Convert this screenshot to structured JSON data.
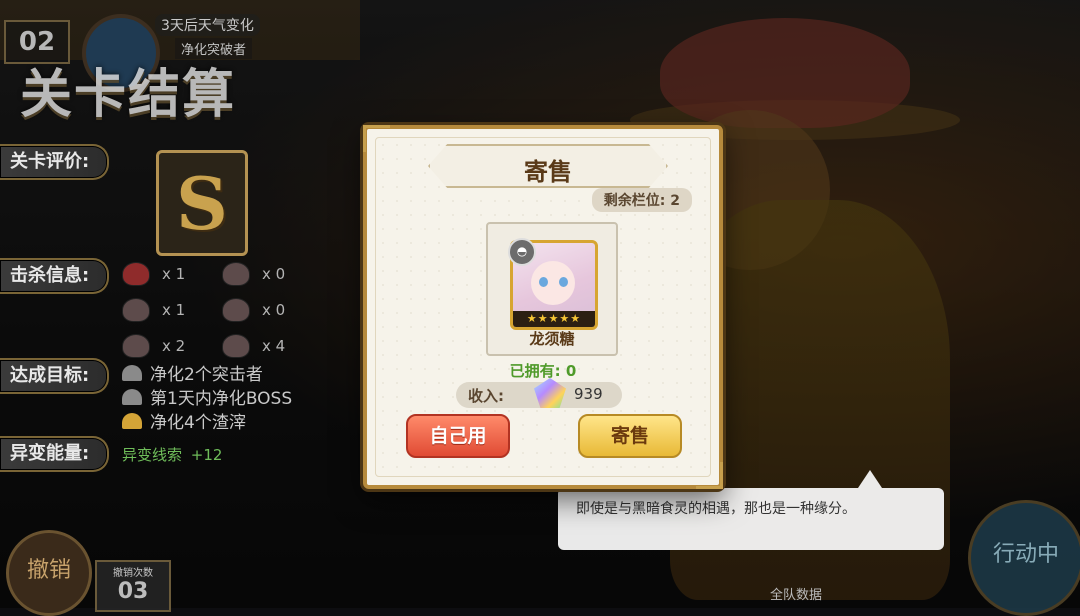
{
  "header": {
    "day_number": "02",
    "weather_text": "3天后天气变化",
    "weather_sub": "净化突破者",
    "title": "关卡结算"
  },
  "evaluation": {
    "label": "关卡评价:",
    "rank": "S"
  },
  "kills": {
    "label": "击杀信息:",
    "rows": [
      [
        "x 1",
        "x 0"
      ],
      [
        "x 1",
        "x 0"
      ],
      [
        "x 2",
        "x 4"
      ]
    ]
  },
  "goals": {
    "label": "达成目标:",
    "items": [
      "净化2个突击者",
      "第1天内净化BOSS",
      "净化4个渣滓"
    ]
  },
  "anomaly": {
    "label": "异变能量:",
    "key": "异变线索",
    "value": "+12"
  },
  "bottom": {
    "revoke": "撤销",
    "revoke_count_label": "撤销次数",
    "revoke_count": "03",
    "action": "行动中",
    "team": "全队数据"
  },
  "speech": {
    "text": "即使是与黑暗食灵的相遇，那也是一种缘分。"
  },
  "dialog": {
    "title": "寄售",
    "remaining_slots": "剩余栏位: 2",
    "item_name": "龙须糖",
    "item_stars": "★★★★★",
    "owned": "已拥有:   0",
    "income_label": "收入:",
    "income_value": "939",
    "btn_use": "自己用",
    "btn_sell": "寄售"
  }
}
